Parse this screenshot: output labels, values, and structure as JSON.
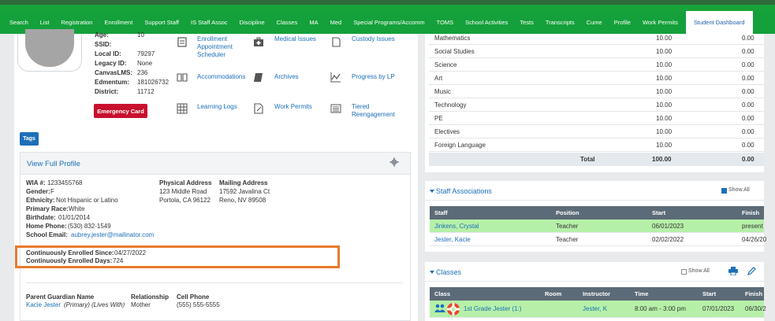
{
  "nav": {
    "tabs": [
      "Search",
      "List",
      "Registration",
      "Enrollment",
      "Support Staff",
      "IS Staff Assoc",
      "Discipline",
      "Classes",
      "MA",
      "Med",
      "Special Programs/Accomm",
      "TOMS",
      "School Activities",
      "Tests",
      "Transcripts",
      "Cume",
      "Profile",
      "Work Permits",
      "Student Dashboard"
    ],
    "active": "Student Dashboard"
  },
  "student": {
    "age_label": "Age:",
    "age": "10",
    "ssid_label": "SSID:",
    "local_id_label": "Local ID:",
    "local_id": "79297",
    "legacy_id_label": "Legacy ID:",
    "legacy_id": "None",
    "canvas_label": "CanvasLMS:",
    "canvas": "236",
    "edmentum_label": "Edmentum:",
    "edmentum": "181026732",
    "district_label": "District:",
    "district": "11712",
    "emergency_card": "Emergency Card",
    "tags": "Tags"
  },
  "quicklinks": {
    "enrollment_scheduler": [
      "Enrollment",
      "Appointment",
      "Scheduler"
    ],
    "medical_issues": "Medical Issues",
    "custody_issues": "Custody Issues",
    "accommodations": "Accommodations",
    "archives": "Archives",
    "progress_by_lp": "Progress by LP",
    "learning_logs": "Learning Logs",
    "work_permits": "Work Permits",
    "tiered_reengagement": [
      "Tiered",
      "Reengagement"
    ]
  },
  "profile": {
    "title": "View Full Profile",
    "wia_label": "WIA #:",
    "wia": "1233455768",
    "gender_label": "Gender:",
    "gender": "F",
    "ethnicity_label": "Ethnicity:",
    "ethnicity": "Not Hispanic or Latino",
    "race_label": "Primary Race:",
    "race": "White",
    "birthdate_label": "Birthdate:",
    "birthdate": "01/01/2014",
    "home_phone_label": "Home Phone:",
    "home_phone": "(530) 832-1549",
    "school_email_label": "School Email:",
    "school_email": "aubrey.jester@mailinator.com",
    "enrolled_since_label": "Continuously Enrolled Since:",
    "enrolled_since": "04/27/2022",
    "enrolled_days_label": "Continuously Enrolled Days:",
    "enrolled_days": "724",
    "physical_address_label": "Physical Address",
    "physical_address": [
      "123 Middle Road",
      "Portola, CA 96122"
    ],
    "mailing_address_label": "Mailing Address",
    "mailing_address": [
      "17592 Javalina Ct",
      "Reno, NV 89508"
    ],
    "guardian_header": "Parent Guardian Name",
    "relationship_header": "Relationship",
    "cell_header": "Cell Phone",
    "guardian_name": "Kacie Jester",
    "guardian_note": " (Primary) (Lives With)",
    "guardian_relationship": "Mother",
    "guardian_cell": "(555) 555-5555"
  },
  "grades": {
    "rows": [
      {
        "subject": "Mathematics",
        "a": "10.00",
        "b": "0.00"
      },
      {
        "subject": "Social Studies",
        "a": "10.00",
        "b": "0.00"
      },
      {
        "subject": "Science",
        "a": "10.00",
        "b": "0.00"
      },
      {
        "subject": "Art",
        "a": "10.00",
        "b": "0.00"
      },
      {
        "subject": "Music",
        "a": "10.00",
        "b": "0.00"
      },
      {
        "subject": "Technology",
        "a": "10.00",
        "b": "0.00"
      },
      {
        "subject": "PE",
        "a": "10.00",
        "b": "0.00"
      },
      {
        "subject": "Electives",
        "a": "10.00",
        "b": "0.00"
      },
      {
        "subject": "Foreign Language",
        "a": "10.00",
        "b": "0.00"
      }
    ],
    "total_label": "Total",
    "total_a": "100.00",
    "total_b": "0.00"
  },
  "staff": {
    "title": "Staff Associations",
    "show_all": "Show All",
    "headers": [
      "Staff",
      "Position",
      "Start",
      "Finish"
    ],
    "rows": [
      {
        "name": "Jinkens, Crystal",
        "position": "Teacher",
        "start": "06/01/2023",
        "finish": "present"
      },
      {
        "name": "Jester, Kacie",
        "position": "Teacher",
        "start": "02/02/2022",
        "finish": "04/26/20"
      }
    ]
  },
  "classes": {
    "title": "Classes",
    "show_all": "Show All",
    "headers": [
      "Class",
      "Room",
      "Instructor",
      "Time",
      "Start",
      "Finish"
    ],
    "rows": [
      {
        "class": "1st Grade Jester (1:)",
        "room": "",
        "instructor": "Jester, K",
        "time": "8:00 am - 3:00 pm",
        "start": "07/01/2023",
        "finish": "06/30/2"
      }
    ]
  },
  "colors": {
    "nav_green": "#14a03a",
    "link_blue": "#1d6fb8",
    "emergency_red": "#c8102e",
    "highlight_orange": "#e8792c",
    "row_green": "#b6f0a8"
  }
}
